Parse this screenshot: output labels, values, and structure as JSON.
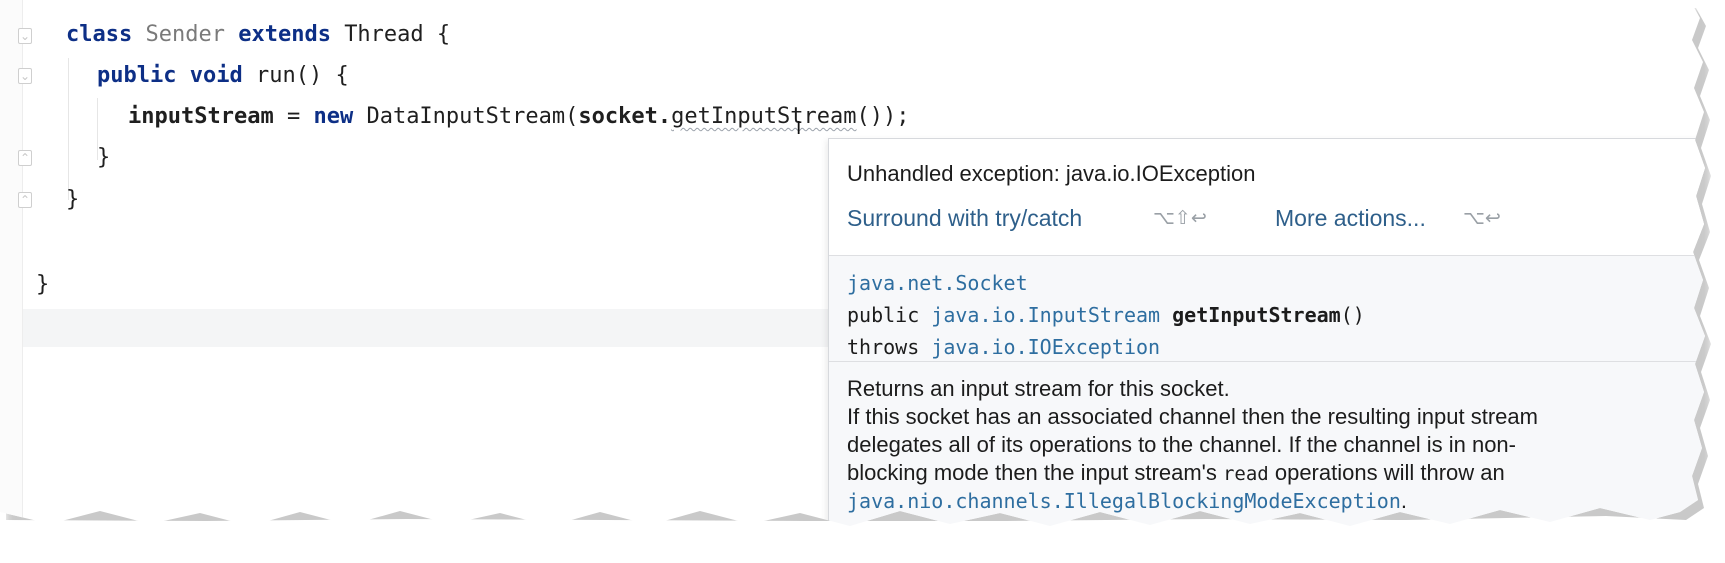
{
  "editor": {
    "line1": {
      "kw1": "class",
      "name": "Sender",
      "kw2": "extends",
      "rest": "Thread {"
    },
    "line2": {
      "kw1": "public",
      "kw2": "void",
      "rest": "run() {"
    },
    "line3": {
      "var": "inputStream",
      "eq": " = ",
      "kw": "new",
      "call": "DataInputStream(",
      "obj": "socket.",
      "method": "getInputStream",
      "tail": "());"
    },
    "line4": "}",
    "line5": "}",
    "line6": "}"
  },
  "popup": {
    "title": "Unhandled exception: java.io.IOException",
    "action1": "Surround with try/catch",
    "action1_shortcut": "⌥⇧↩",
    "action2": "More actions...",
    "action2_shortcut": "⌥↩",
    "sig_class": "java.net.Socket",
    "sig_public": "public ",
    "sig_type": "java.io.InputStream",
    "sig_method": "getInputStream",
    "sig_parens": "()",
    "sig_throws": "throws ",
    "sig_exception": "java.io.IOException",
    "doc1": "Returns an input stream for this socket.",
    "doc2": "If this socket has an associated channel then the resulting input stream",
    "doc3": "delegates all of its operations to the channel. If the channel is in non-",
    "doc4a": "blocking mode then the input stream's ",
    "doc4code": "read",
    "doc4b": " operations will throw an",
    "doc5link": "java.nio.channels.IllegalBlockingModeException",
    "doc5tail": "."
  }
}
